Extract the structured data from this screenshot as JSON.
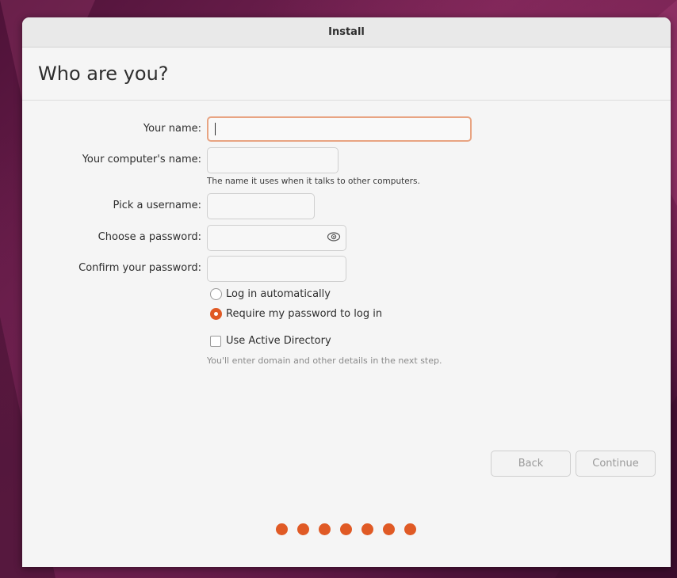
{
  "window": {
    "title": "Install"
  },
  "page": {
    "heading": "Who are you?"
  },
  "form": {
    "your_name": {
      "label": "Your name:",
      "value": ""
    },
    "computer_name": {
      "label": "Your computer's name:",
      "value": "",
      "hint": "The name it uses when it talks to other computers."
    },
    "username": {
      "label": "Pick a username:",
      "value": ""
    },
    "password": {
      "label": "Choose a password:",
      "value": "",
      "reveal_icon": "eye-icon"
    },
    "confirm_password": {
      "label": "Confirm your password:",
      "value": ""
    }
  },
  "login_options": [
    {
      "label": "Log in automatically",
      "selected": false
    },
    {
      "label": "Require my password to log in",
      "selected": true
    }
  ],
  "active_directory": {
    "label": "Use Active Directory",
    "checked": false,
    "hint": "You'll enter domain and other details in the next step."
  },
  "buttons": {
    "back": "Back",
    "continue": "Continue"
  },
  "progress": {
    "total_steps": 7
  },
  "colors": {
    "accent": "#e05a25",
    "focus_border": "#e8a482"
  }
}
